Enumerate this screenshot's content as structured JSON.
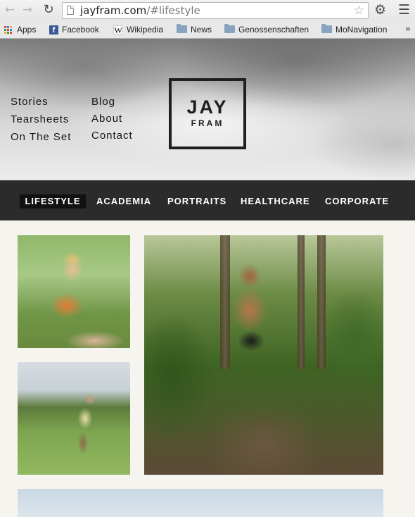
{
  "browser": {
    "url_host": "jayfram.com",
    "url_path": "/#lifestyle",
    "bookmarks": [
      {
        "label": "Apps",
        "icon": "apps-grid-icon"
      },
      {
        "label": "Facebook",
        "icon": "facebook-icon"
      },
      {
        "label": "Wikipedia",
        "icon": "wikipedia-icon"
      },
      {
        "label": "News",
        "icon": "folder-icon"
      },
      {
        "label": "Genossenschaften",
        "icon": "folder-icon"
      },
      {
        "label": "MoNavigation",
        "icon": "folder-icon"
      }
    ],
    "overflow_glyph": "»"
  },
  "site": {
    "nav_left": [
      "Stories",
      "Tearsheets",
      "On The Set"
    ],
    "nav_right": [
      "Blog",
      "About",
      "Contact"
    ],
    "logo_line1": "JAY",
    "logo_line2": "FRAM",
    "categories": [
      {
        "label": "LIFESTYLE",
        "active": true
      },
      {
        "label": "ACADEMIA",
        "active": false
      },
      {
        "label": "PORTRAITS",
        "active": false
      },
      {
        "label": "HEALTHCARE",
        "active": false
      },
      {
        "label": "CORPORATE",
        "active": false
      }
    ]
  },
  "colors": {
    "category_bar": "#2b2b2b",
    "active_category": "#111111",
    "page_background": "#f6f4ef"
  }
}
